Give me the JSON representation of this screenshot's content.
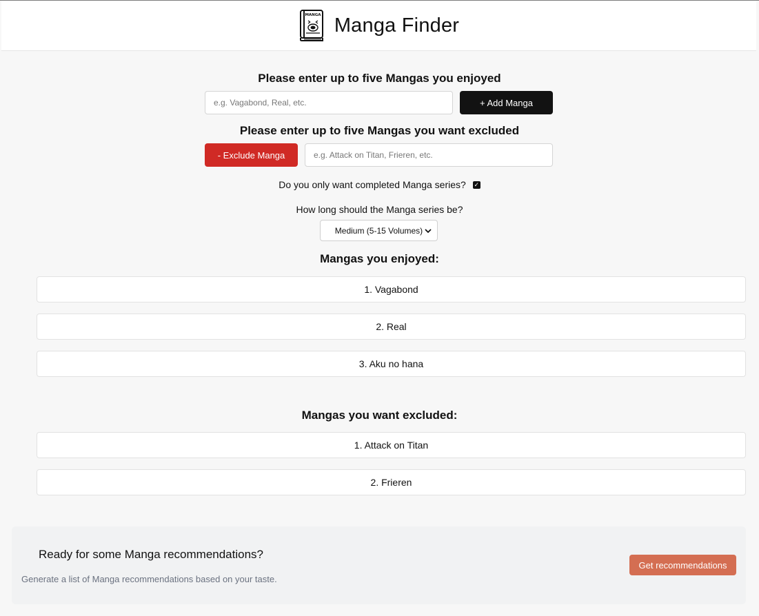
{
  "app": {
    "title": "Manga Finder",
    "logo_text": "MANGA",
    "logo_icon": "manga-book-icon"
  },
  "enjoyed_section": {
    "heading": "Please enter up to five Mangas you enjoyed",
    "input_placeholder": "e.g. Vagabond, Real, etc.",
    "input_value": "",
    "add_button": "+ Add Manga"
  },
  "excluded_section": {
    "heading": "Please enter up to five Mangas you want excluded",
    "exclude_button": "- Exclude Manga",
    "input_placeholder": "e.g. Attack on Titan, Frieren, etc.",
    "input_value": ""
  },
  "filters": {
    "completed_label": "Do you only want completed Manga series?",
    "completed_checked": true,
    "length_label": "How long should the Manga series be?",
    "length_selected": "Medium (5-15 Volumes)"
  },
  "enjoyed_list": {
    "heading": "Mangas you enjoyed:",
    "items": [
      "1. Vagabond",
      "2. Real",
      "3. Aku no hana"
    ]
  },
  "excluded_list": {
    "heading": "Mangas you want excluded:",
    "items": [
      "1. Attack on Titan",
      "2. Frieren"
    ]
  },
  "cta": {
    "title": "Ready for some Manga recommendations?",
    "subtitle": "Generate a list of Manga recommendations based on your taste.",
    "button": "Get recommendations"
  },
  "colors": {
    "add_button": "#121212",
    "exclude_button": "#d02a25",
    "recommend_button": "#d46e52",
    "page_background": "#f7f7f7"
  }
}
